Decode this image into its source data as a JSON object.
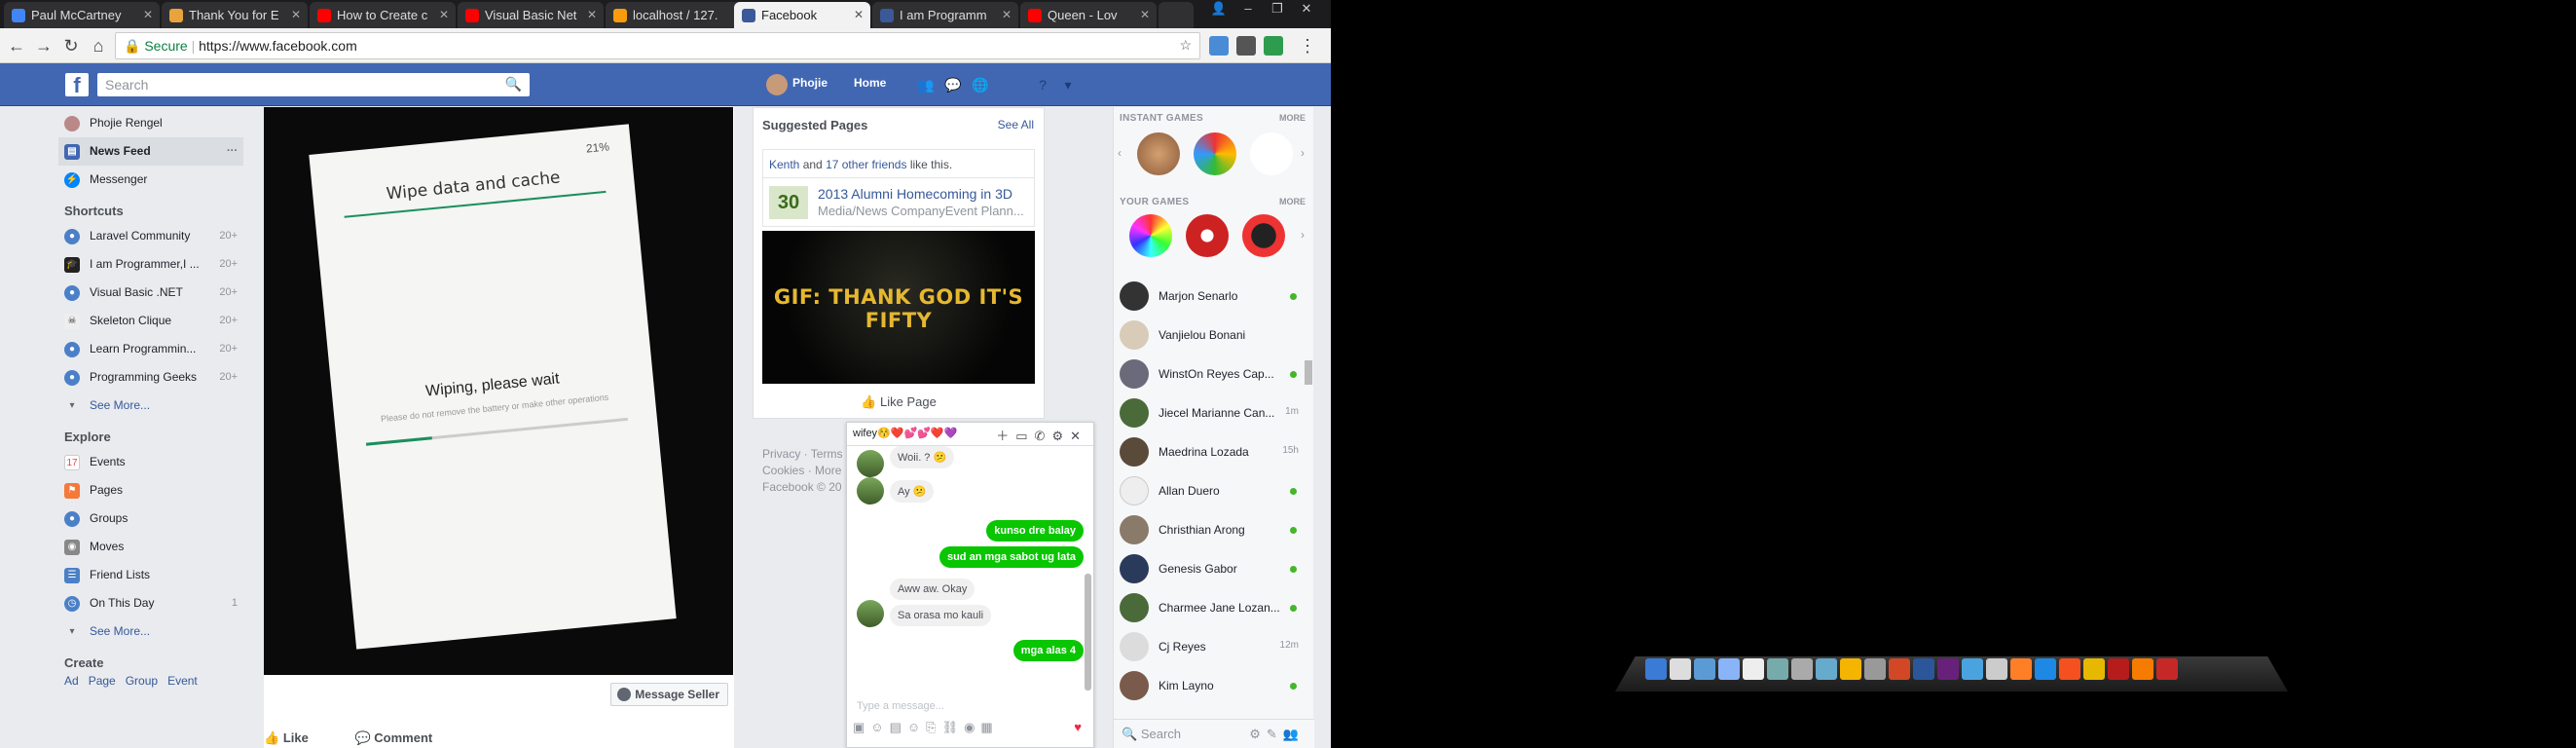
{
  "browser": {
    "tabs": [
      {
        "title": "Paul McCartney",
        "color": "#4285f4"
      },
      {
        "title": "Thank You for E",
        "color": "#e8a33d"
      },
      {
        "title": "How to Create c",
        "color": "#ff0000"
      },
      {
        "title": "Visual Basic Net",
        "color": "#ff0000"
      },
      {
        "title": "localhost / 127.",
        "color": "#f89c0e"
      },
      {
        "title": "Facebook",
        "color": "#3b5998"
      },
      {
        "title": "I am Programm",
        "color": "#3b5998"
      },
      {
        "title": "Queen - Lov",
        "color": "#ff0000"
      }
    ],
    "secure_label": "Secure",
    "url": "https://www.facebook.com"
  },
  "fb": {
    "logo": "f",
    "search_placeholder": "Search",
    "user_short": "Phojie",
    "home": "Home"
  },
  "left_nav": {
    "profile": "Phojie Rengel",
    "news_feed": "News Feed",
    "more": "···",
    "messenger": "Messenger",
    "shortcuts_title": "Shortcuts",
    "shortcuts": [
      {
        "label": "Laravel Community",
        "count": "20+"
      },
      {
        "label": "I am Programmer,I ...",
        "count": "20+"
      },
      {
        "label": "Visual Basic .NET",
        "count": "20+"
      },
      {
        "label": "Skeleton Clique",
        "count": "20+"
      },
      {
        "label": "Learn Programmin...",
        "count": "20+"
      },
      {
        "label": "Programming Geeks",
        "count": "20+"
      }
    ],
    "see_more": "See More...",
    "explore_title": "Explore",
    "explore": [
      {
        "label": "Events",
        "count": ""
      },
      {
        "label": "Pages",
        "count": ""
      },
      {
        "label": "Groups",
        "count": ""
      },
      {
        "label": "Moves",
        "count": ""
      },
      {
        "label": "Friend Lists",
        "count": ""
      },
      {
        "label": "On This Day",
        "count": "1"
      }
    ],
    "see_more2": "See More...",
    "create_title": "Create",
    "create_links": [
      "Ad",
      "Page",
      "Group",
      "Event"
    ]
  },
  "post": {
    "phone_battery": "21%",
    "phone_title": "Wipe data and cache",
    "phone_status": "Wiping, please wait",
    "phone_sub": "Please do not remove the battery or make other operations",
    "progress": 0.25,
    "message_seller": "Message Seller",
    "like": "Like",
    "comment": "Comment"
  },
  "suggested": {
    "title": "Suggested Pages",
    "see_all": "See All",
    "friends_a": "Kenth",
    "friends_and": "and",
    "friends_b": "17 other friends",
    "friends_c": "like this.",
    "logo": "30",
    "page_name": "2013 Alumni Homecoming in 3D",
    "page_cat": "Media/News CompanyEvent Plann...",
    "gif_text": "GIF: THANK GOD IT'S FIFTY",
    "like_page": "Like Page"
  },
  "footer": {
    "line1a": "Privacy",
    "line1b": "Terms",
    "line2a": "Cookies",
    "line2b": "More",
    "line3": "Facebook © 20"
  },
  "chat": {
    "title": "wifey😚❤️💕💕❤️💜",
    "messages": [
      {
        "text": "Woii. ? 😕",
        "dir": "in"
      },
      {
        "text": "Ay 😕",
        "dir": "in"
      },
      {
        "text": "kunso dre balay",
        "dir": "out"
      },
      {
        "text": "sud an mga sabot ug lata",
        "dir": "out"
      },
      {
        "text": "Aww aw. Okay",
        "dir": "in"
      },
      {
        "text": "Sa orasa mo kauli",
        "dir": "in"
      },
      {
        "text": "mga alas 4",
        "dir": "out"
      }
    ],
    "placeholder": "Type a message..."
  },
  "right": {
    "instant_games": "INSTANT GAMES",
    "your_games": "YOUR GAMES",
    "more": "MORE",
    "contacts": [
      {
        "name": "Marjon Senarlo",
        "status": "online"
      },
      {
        "name": "Vanjielou Bonani",
        "status": ""
      },
      {
        "name": "WinstOn Reyes Cap...",
        "status": "online"
      },
      {
        "name": "Jiecel Marianne Can...",
        "status": "1m"
      },
      {
        "name": "Maedrina Lozada",
        "status": "15h"
      },
      {
        "name": "Allan Duero",
        "status": "online"
      },
      {
        "name": "Christhian Arong",
        "status": "online"
      },
      {
        "name": "Genesis Gabor",
        "status": "online"
      },
      {
        "name": "Charmee Jane Lozan...",
        "status": "online"
      },
      {
        "name": "Cj Reyes",
        "status": "12m"
      },
      {
        "name": "Kim Layno",
        "status": "online"
      }
    ],
    "search": "Search"
  },
  "colors": {
    "fb_blue": "#4267b2",
    "chat_green": "#09c600",
    "link": "#365899"
  }
}
